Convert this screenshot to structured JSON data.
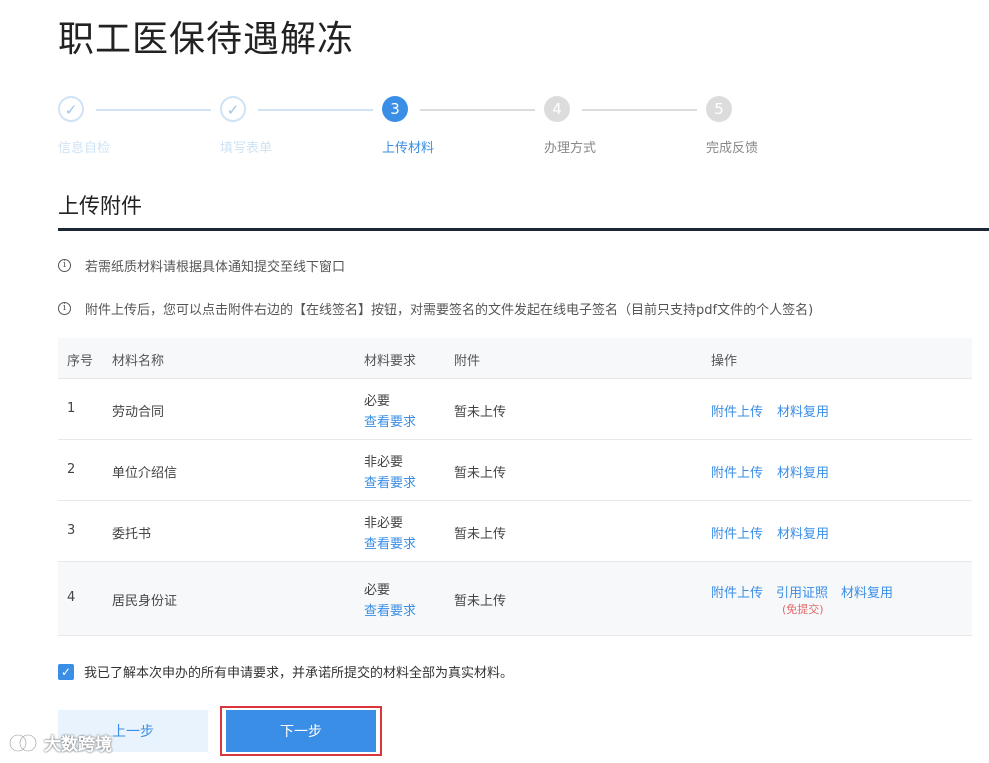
{
  "page": {
    "title": "职工医保待遇解冻"
  },
  "steps": [
    {
      "number": "✓",
      "label": "信息自检",
      "state": "done"
    },
    {
      "number": "✓",
      "label": "填写表单",
      "state": "done"
    },
    {
      "number": "3",
      "label": "上传材料",
      "state": "active"
    },
    {
      "number": "4",
      "label": "办理方式",
      "state": "todo"
    },
    {
      "number": "5",
      "label": "完成反馈",
      "state": "todo"
    }
  ],
  "section": {
    "title": "上传附件"
  },
  "notices": [
    "若需纸质材料请根据具体通知提交至线下窗口",
    "附件上传后，您可以点击附件右边的【在线签名】按钮，对需要签名的文件发起在线电子签名（目前只支持pdf文件的个人签名)"
  ],
  "table": {
    "headers": {
      "index": "序号",
      "name": "材料名称",
      "requirement": "材料要求",
      "attachment": "附件",
      "actions": "操作"
    },
    "rows": [
      {
        "index": "1",
        "name": "劳动合同",
        "requirement": "必要",
        "view_req": "查看要求",
        "attachment": "暂未上传",
        "upload": "附件上传",
        "reuse": "材料复用"
      },
      {
        "index": "2",
        "name": "单位介绍信",
        "requirement": "非必要",
        "view_req": "查看要求",
        "attachment": "暂未上传",
        "upload": "附件上传",
        "reuse": "材料复用"
      },
      {
        "index": "3",
        "name": "委托书",
        "requirement": "非必要",
        "view_req": "查看要求",
        "attachment": "暂未上传",
        "upload": "附件上传",
        "reuse": "材料复用"
      },
      {
        "index": "4",
        "name": "居民身份证",
        "requirement": "必要",
        "view_req": "查看要求",
        "attachment": "暂未上传",
        "upload": "附件上传",
        "cite": "引用证照",
        "cite_note": "(免提交)",
        "reuse": "材料复用"
      }
    ]
  },
  "agreement": {
    "checked": true,
    "text": "我已了解本次申办的所有申请要求，并承诺所提交的材料全部为真实材料。"
  },
  "buttons": {
    "prev": "上一步",
    "next": "下一步"
  },
  "watermark": {
    "text": "大数跨境"
  },
  "colors": {
    "accent": "#3a8ee6",
    "highlight_border": "#d9363e",
    "free_note": "#e26a6a"
  }
}
